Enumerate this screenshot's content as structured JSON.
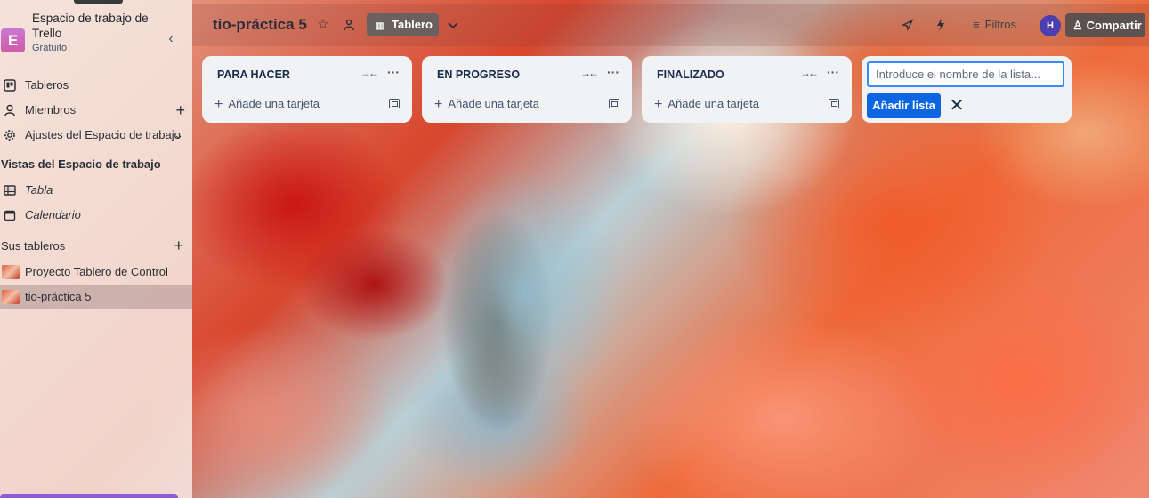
{
  "sidebar": {
    "workspace_initial": "E",
    "workspace_name": "Espacio de trabajo de Trello",
    "workspace_plan": "Gratuito",
    "collapse_icon": "‹",
    "items": [
      {
        "label": "Tableros"
      },
      {
        "label": "Miembros"
      },
      {
        "label": "Ajustes del Espacio de trabajo"
      }
    ],
    "views_heading": "Vistas del Espacio de trabajo",
    "views": [
      {
        "label": "Tabla"
      },
      {
        "label": "Calendario"
      }
    ],
    "boards_heading": "Sus tableros",
    "boards": [
      {
        "label": "Proyecto Tablero de Control"
      },
      {
        "label": "tio-práctica 5"
      }
    ]
  },
  "topbar": {
    "board_title": "tio-práctica 5",
    "view_button": "Tablero",
    "filters": "Filtros",
    "user_initial": "H",
    "share": "Compartir"
  },
  "lists": [
    {
      "title": "PARA HACER",
      "add_card": "Añade una tarjeta"
    },
    {
      "title": "EN PROGRESO",
      "add_card": "Añade una tarjeta"
    },
    {
      "title": "FINALIZADO",
      "add_card": "Añade una tarjeta"
    }
  ],
  "new_list": {
    "placeholder": "Introduce el nombre de la lista...",
    "add_button": "Añadir lista",
    "close": "✕"
  },
  "colors": {
    "primary_button": "#0c66e4",
    "input_focus": "#388bff",
    "list_bg": "#f1f2f4",
    "workspace_avatar": "#c879d4",
    "user_avatar": "#4b3fb0"
  }
}
